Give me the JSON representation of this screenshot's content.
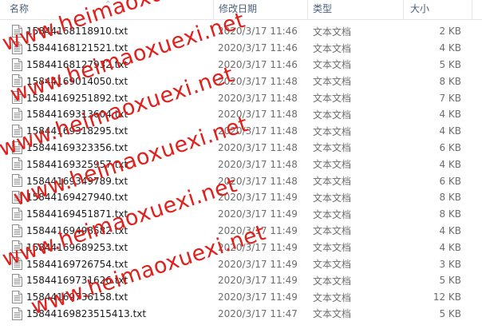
{
  "columns": {
    "name": "名称",
    "date": "修改日期",
    "type": "类型",
    "size": "大小"
  },
  "files": [
    {
      "name": "15844168118910.txt",
      "date": "2020/3/17 11:46",
      "type": "文本文档",
      "size": "2 KB"
    },
    {
      "name": "15844168121521.txt",
      "date": "2020/3/17 11:46",
      "type": "文本文档",
      "size": "4 KB"
    },
    {
      "name": "15844168127932.txt",
      "date": "2020/3/17 11:46",
      "type": "文本文档",
      "size": "5 KB"
    },
    {
      "name": "15844169014050.txt",
      "date": "2020/3/17 11:48",
      "type": "文本文档",
      "size": "8 KB"
    },
    {
      "name": "15844169251892.txt",
      "date": "2020/3/17 11:48",
      "type": "文本文档",
      "size": "7 KB"
    },
    {
      "name": "15844169313604.txt",
      "date": "2020/3/17 11:48",
      "type": "文本文档",
      "size": "4 KB"
    },
    {
      "name": "15844169318295.txt",
      "date": "2020/3/17 11:48",
      "type": "文本文档",
      "size": "4 KB"
    },
    {
      "name": "15844169323356.txt",
      "date": "2020/3/17 11:48",
      "type": "文本文档",
      "size": "6 KB"
    },
    {
      "name": "15844169325957.txt",
      "date": "2020/3/17 11:48",
      "type": "文本文档",
      "size": "4 KB"
    },
    {
      "name": "15844169349789.txt",
      "date": "2020/3/17 11:48",
      "type": "文本文档",
      "size": "6 KB"
    },
    {
      "name": "15844169427940.txt",
      "date": "2020/3/17 11:49",
      "type": "文本文档",
      "size": "8 KB"
    },
    {
      "name": "15844169451871.txt",
      "date": "2020/3/17 11:49",
      "type": "文本文档",
      "size": "8 KB"
    },
    {
      "name": "15844169498582.txt",
      "date": "2020/3/17 11:49",
      "type": "文本文档",
      "size": "4 KB"
    },
    {
      "name": "15844169689253.txt",
      "date": "2020/3/17 11:49",
      "type": "文本文档",
      "size": "4 KB"
    },
    {
      "name": "15844169726754.txt",
      "date": "2020/3/17 11:49",
      "type": "文本文档",
      "size": "3 KB"
    },
    {
      "name": "15844169731626.txt",
      "date": "2020/3/17 11:49",
      "type": "文本文档",
      "size": "5 KB"
    },
    {
      "name": "15844169736158.txt",
      "date": "2020/3/17 11:49",
      "type": "文本文档",
      "size": "12 KB"
    },
    {
      "name": "15844169823515413.txt",
      "date": "2020/3/17 11:47",
      "type": "文本文档",
      "size": "5 KB"
    }
  ],
  "watermark": {
    "text": "www.heimaoxuexi.net",
    "color": "#e0201c"
  },
  "icon": "text-file-icon"
}
